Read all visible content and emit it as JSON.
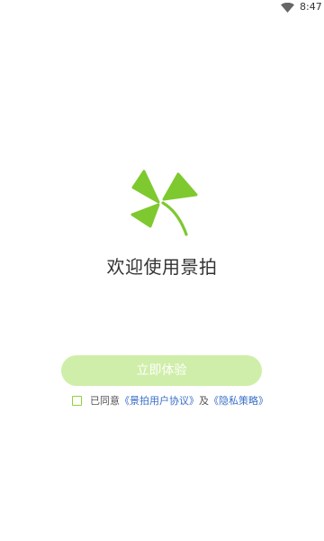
{
  "status_bar": {
    "time": "8:47",
    "icons": [
      "wifi-icon"
    ]
  },
  "welcome": {
    "title": "欢迎使用景拍"
  },
  "start_button": {
    "label": "立即体验"
  },
  "agreement": {
    "prefix": "已同意",
    "user_agreement": "《景拍用户协议》",
    "connector": "及",
    "privacy_policy": "《隐私策略》"
  },
  "colors": {
    "brand_green": "#7ec92f",
    "button_disabled": "#cfeea9",
    "link_blue": "#3a6fc7"
  }
}
